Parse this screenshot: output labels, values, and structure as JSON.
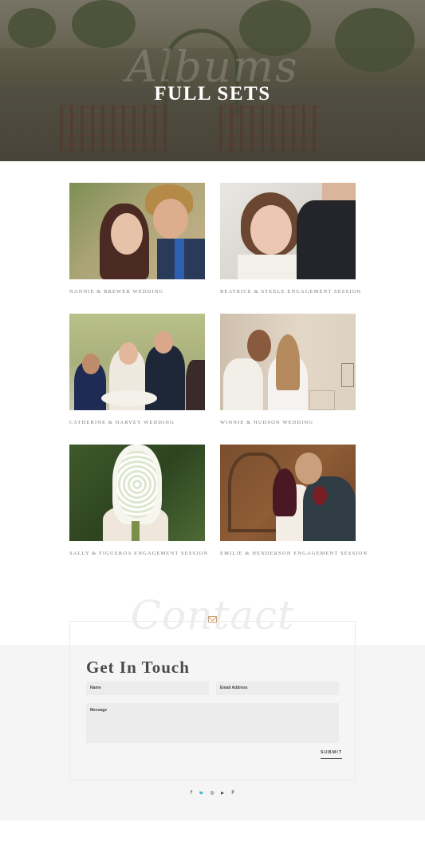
{
  "hero": {
    "script_text": "Albums",
    "title": "FULL SETS"
  },
  "albums": [
    {
      "caption": "NANNIE & BREWER WEDDING"
    },
    {
      "caption": "BEATRICE & STEELE ENGAGEMENT SESSION"
    },
    {
      "caption": "CATHERINE & HARVEY WEDDING"
    },
    {
      "caption": "WINNIE & HUDSON WEDDING"
    },
    {
      "caption": "SALLY & FIGUEROA ENGAGEMENT SESSION"
    },
    {
      "caption": "EMILIE & HENDERSON ENGAGEMENT SESSION"
    }
  ],
  "contact": {
    "script_text": "Contact",
    "heading": "Get In Touch",
    "name_placeholder": "Name",
    "email_placeholder": "Email Address",
    "message_placeholder": "Message",
    "submit_label": "SUBMIT"
  },
  "social": {
    "facebook": "f",
    "twitter": "🐦",
    "instagram": "◎",
    "youtube": "▶",
    "pinterest": "P"
  },
  "colors": {
    "accent": "#c9a27a",
    "section_bg": "#f5f5f5",
    "field_bg": "#ececec"
  }
}
